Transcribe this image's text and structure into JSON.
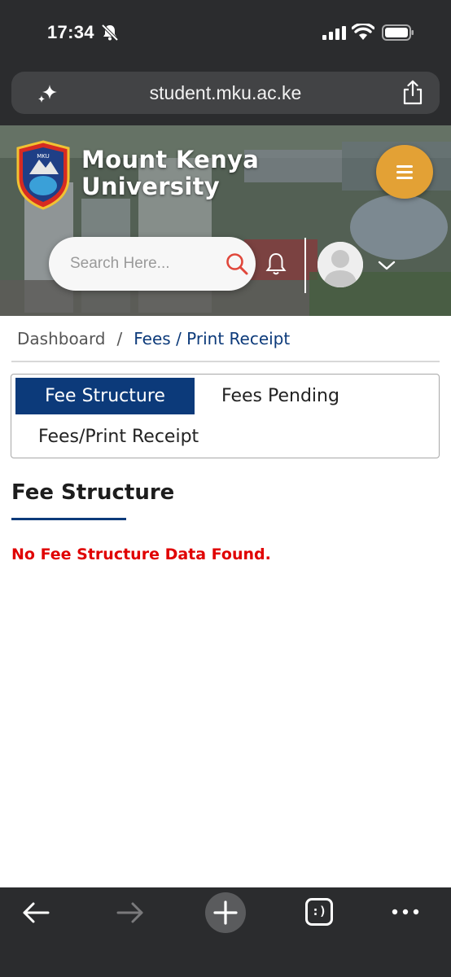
{
  "status_bar": {
    "time": "17:34",
    "icons": [
      "bell-slash-icon",
      "signal-icon",
      "wifi-icon",
      "battery-icon"
    ]
  },
  "browser": {
    "url": "student.mku.ac.ke",
    "icons": [
      "sparkle-icon",
      "share-icon"
    ]
  },
  "header": {
    "brand_line1": "Mount Kenya",
    "brand_line2": "University",
    "search_placeholder": "Search Here...",
    "icons": [
      "logo-shield",
      "menu-icon",
      "search-icon",
      "bell-icon",
      "avatar",
      "chevron-down-icon"
    ],
    "accent_color": "#e3a135"
  },
  "breadcrumb": {
    "home": "Dashboard",
    "separator": "/",
    "current": "Fees / Print Receipt"
  },
  "tabs": {
    "items": [
      "Fee Structure",
      "Fees Pending",
      "Fees/Print Receipt"
    ],
    "active": "Fee Structure",
    "active_color": "#0c3a7a"
  },
  "section": {
    "title": "Fee Structure",
    "empty_message": "No Fee Structure Data Found.",
    "message_color": "#e00000"
  },
  "toolbar": {
    "tabs_label": ":)",
    "icons": [
      "back-arrow-icon",
      "forward-arrow-icon",
      "plus-icon",
      "tabs-icon",
      "more-dots-icon"
    ]
  }
}
